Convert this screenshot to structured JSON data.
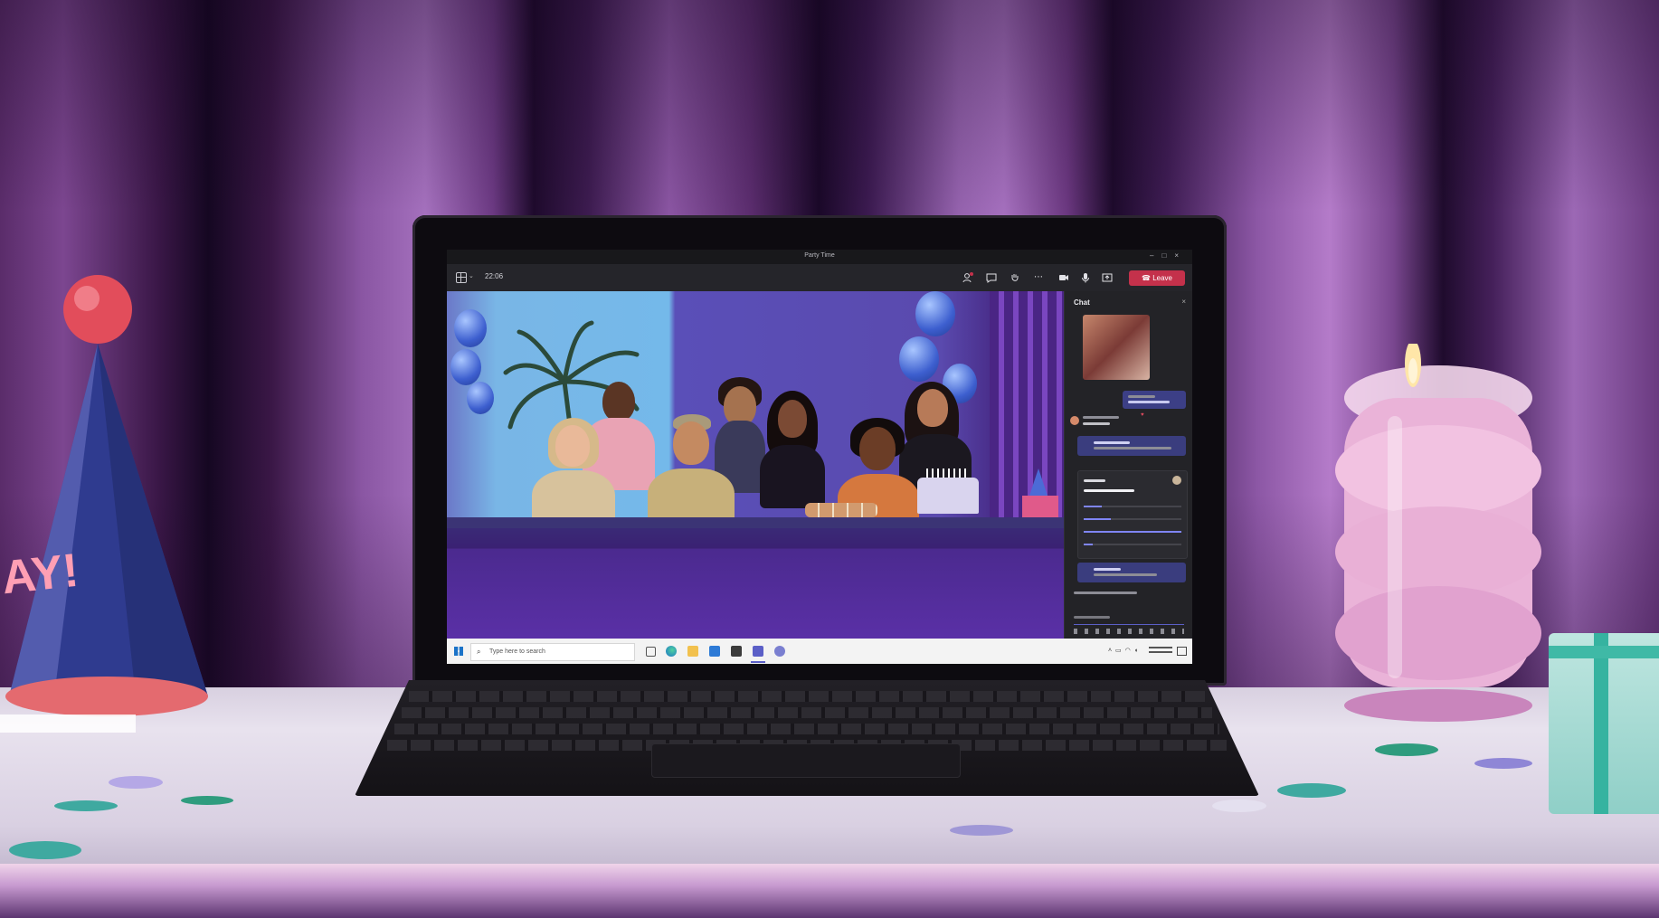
{
  "scene": {
    "hat_text": "AY!",
    "colors": {
      "curtain": "#8a56a3",
      "teams_accent": "#5b5fc7",
      "leave_red": "#c4314b"
    }
  },
  "window": {
    "title": "Party Time",
    "controls_icons": [
      "minimize-icon",
      "maximize-icon",
      "close-icon"
    ]
  },
  "toolbar": {
    "timer": "22:06",
    "leave_label": "Leave",
    "icons": [
      "participants-icon",
      "chat-icon",
      "raise-hand-icon",
      "more-icon",
      "camera-icon",
      "mic-icon",
      "share-icon"
    ]
  },
  "chat": {
    "title": "Chat"
  },
  "taskbar": {
    "search_placeholder": "Type here to search"
  }
}
